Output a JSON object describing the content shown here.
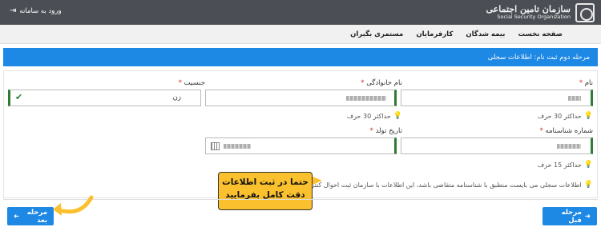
{
  "header": {
    "logo_fa": "سازمان تامین اجتماعی",
    "logo_en": "Social Security Organization",
    "login_label": "ورود به سامانه"
  },
  "nav": {
    "items": [
      "صفحه نخست",
      "بیمه شدگان",
      "کارفرمایان",
      "مستمری بگیران"
    ]
  },
  "step": {
    "title": "مرحله دوم ثبت نام: اطلاعات سجلی"
  },
  "form": {
    "name": {
      "label": "نام",
      "required": "*",
      "hint": "حداکثر 30 حرف"
    },
    "family": {
      "label": "نام خانوادگی",
      "required": "*",
      "hint": "حداکثر 30 حرف"
    },
    "gender": {
      "label": "جنسیت",
      "required": "*",
      "value": "زن"
    },
    "id_number": {
      "label": "شماره شناسنامه",
      "required": "*",
      "hint": "حداکثر 15 حرف"
    },
    "birth_date": {
      "label": "تاریخ تولد",
      "required": "*"
    },
    "note": "اطلاعات سجلی می بایست منطبق با شناسنامه متقاضی باشد، این اطلاعات با سازمان ثبت احوال کنترل خواهند شد."
  },
  "callout": {
    "line1": "حتما در ثبت اطلاعات",
    "line2": "دقت کامل بفرمایید"
  },
  "footer": {
    "prev_label": "مرحله قبل",
    "next_label": "مرحله بعد"
  },
  "colors": {
    "accent": "#1e88e5",
    "valid": "#2e7d32",
    "highlight": "#fbc02d",
    "topbar": "#4b4f55"
  }
}
